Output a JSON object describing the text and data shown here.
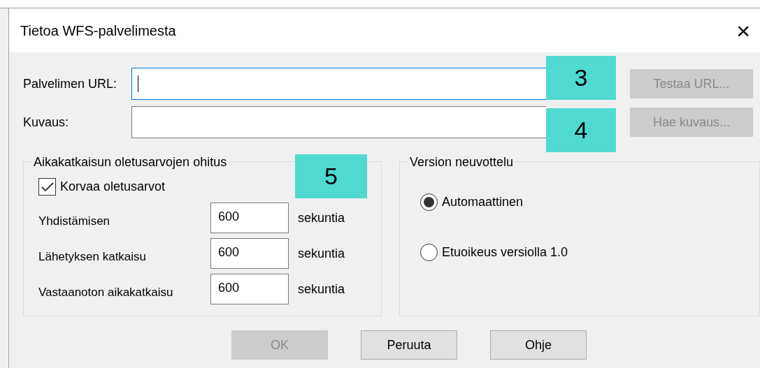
{
  "window": {
    "title": "Tietoa WFS-palvelimesta",
    "close": "×"
  },
  "url": {
    "label": "Palvelimen URL:",
    "focused": true,
    "button": {
      "label": "Testaa URL...",
      "disabled": true
    }
  },
  "description": {
    "label": "Kuvaus:",
    "focused": false,
    "button": {
      "label": "Hae kuvaus...",
      "disabled": true
    }
  },
  "timeouts": {
    "title": "Aikakatkaisun oletusarvojen ohitus",
    "override": {
      "label": "Korvaa oletusarvot",
      "checked": true
    },
    "rows": [
      {
        "label": "Yhdistämisen",
        "value": "600",
        "unit": "sekuntia"
      },
      {
        "label": "Lähetyksen katkaisu",
        "value": "600",
        "unit": "sekuntia"
      },
      {
        "label": "Vastaanoton aikakatkaisu",
        "value": "600",
        "unit": "sekuntia"
      }
    ]
  },
  "version": {
    "title": "Version neuvottelu",
    "options": [
      {
        "label": "Automaattinen",
        "selected": true
      },
      {
        "label": "Etuoikeus versiolla 1.0",
        "selected": false
      }
    ]
  },
  "buttons": [
    {
      "label": "OK",
      "disabled": true
    },
    {
      "label": "Peruuta",
      "disabled": false
    },
    {
      "label": "Ohje",
      "disabled": false
    }
  ],
  "callouts": [
    "3",
    "4",
    "5"
  ]
}
